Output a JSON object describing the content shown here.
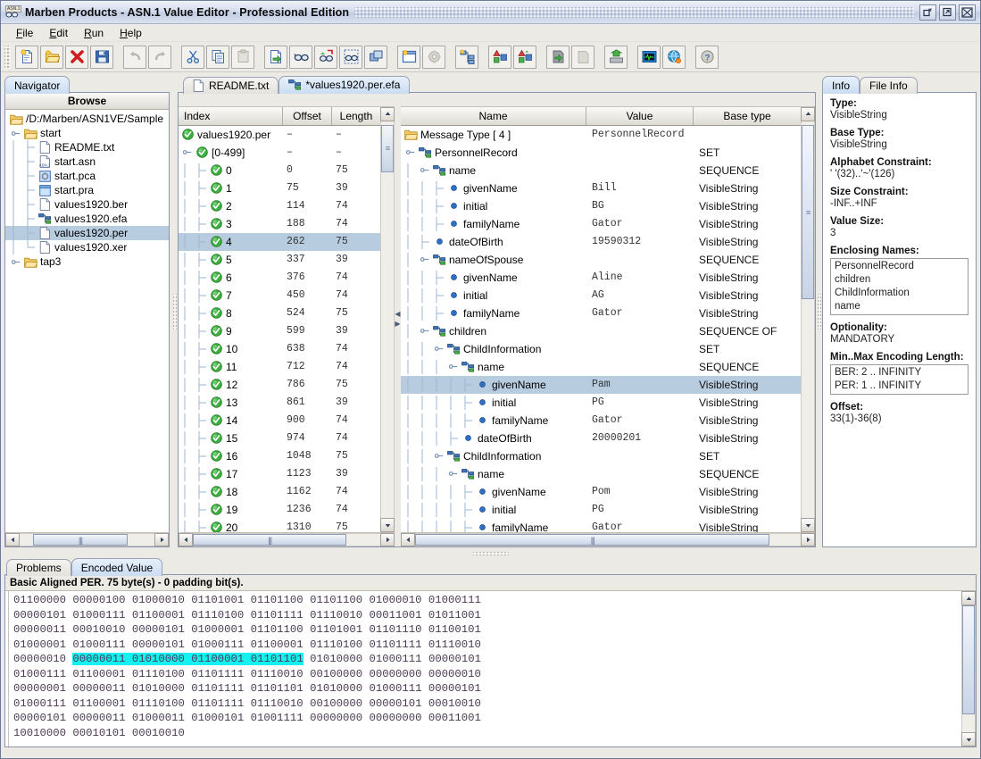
{
  "window": {
    "title": "Marben Products - ASN.1 Value Editor - Professional Edition",
    "icon": "asn1-glasses-icon",
    "buttons": [
      {
        "name": "minimize-button",
        "glyph": "▫"
      },
      {
        "name": "maximize-button",
        "glyph": "▫"
      },
      {
        "name": "close-button",
        "glyph": "✕"
      }
    ]
  },
  "menubar": {
    "items": [
      {
        "label": "File",
        "mnemonic": "F"
      },
      {
        "label": "Edit",
        "mnemonic": "E"
      },
      {
        "label": "Run",
        "mnemonic": "R"
      },
      {
        "label": "Help",
        "mnemonic": "H"
      }
    ]
  },
  "toolbar": {
    "buttons": [
      {
        "name": "new-file-button",
        "icon": "new-document-icon",
        "enabled": true
      },
      {
        "name": "open-file-button",
        "icon": "open-folder-icon",
        "enabled": true
      },
      {
        "name": "delete-button",
        "icon": "red-x-icon",
        "enabled": true
      },
      {
        "name": "save-button",
        "icon": "floppy-disk-icon",
        "enabled": true
      },
      {
        "name": "undo-button",
        "icon": "undo-arrow-icon",
        "enabled": false
      },
      {
        "name": "redo-button",
        "icon": "redo-arrow-icon",
        "enabled": false
      },
      {
        "name": "cut-button",
        "icon": "scissors-icon",
        "enabled": true
      },
      {
        "name": "copy-button",
        "icon": "copy-pages-icon",
        "enabled": true
      },
      {
        "name": "paste-button",
        "icon": "clipboard-icon",
        "enabled": false
      },
      {
        "name": "import-button",
        "icon": "document-green-arrow-icon",
        "enabled": true
      },
      {
        "name": "view-button",
        "icon": "glasses-icon",
        "enabled": true
      },
      {
        "name": "decode-button",
        "icon": "glasses-red-arrow-icon",
        "enabled": true
      },
      {
        "name": "select-view-button",
        "icon": "glasses-dashed-box-icon",
        "enabled": true
      },
      {
        "name": "window-cascade-button",
        "icon": "windows-stack-icon",
        "enabled": true
      },
      {
        "name": "new-window-button",
        "icon": "window-new-icon",
        "enabled": true
      },
      {
        "name": "settings-button",
        "icon": "gear-icon",
        "enabled": false
      },
      {
        "name": "schema-tree-button",
        "icon": "schema-node-icon",
        "enabled": true
      },
      {
        "name": "encode-ber-button",
        "icon": "shapes-blue-icon",
        "enabled": true
      },
      {
        "name": "encode-per-button",
        "icon": "shapes-green-icon",
        "enabled": true
      },
      {
        "name": "save-value-button",
        "icon": "disk-green-arrow-icon",
        "enabled": true
      },
      {
        "name": "load-value-button",
        "icon": "disk-gray-icon",
        "enabled": false
      },
      {
        "name": "export-button",
        "icon": "tray-up-arrow-icon",
        "enabled": true
      },
      {
        "name": "monitor-button",
        "icon": "monitor-icon",
        "enabled": true
      },
      {
        "name": "web-button",
        "icon": "globe-icon",
        "enabled": true
      },
      {
        "name": "help-button",
        "icon": "question-help-icon",
        "enabled": true
      }
    ]
  },
  "navigator": {
    "tab_label": "Navigator",
    "browse_header": "Browse",
    "tree": [
      {
        "label": "/D:/Marben/ASN1VE/Sample",
        "depth": 0,
        "icon": "folder-icon",
        "handle": "none",
        "selected": false
      },
      {
        "label": "start",
        "depth": 1,
        "icon": "folder-icon",
        "handle": "expanded",
        "selected": false
      },
      {
        "label": "README.txt",
        "depth": 2,
        "icon": "text-file-icon",
        "handle": "none",
        "selected": false
      },
      {
        "label": "start.asn",
        "depth": 2,
        "icon": "asn-file-icon",
        "handle": "none",
        "selected": false
      },
      {
        "label": "start.pca",
        "depth": 2,
        "icon": "pca-file-icon",
        "handle": "none",
        "selected": false
      },
      {
        "label": "start.pra",
        "depth": 2,
        "icon": "pra-file-icon",
        "handle": "collapsed",
        "selected": false
      },
      {
        "label": "values1920.ber",
        "depth": 2,
        "icon": "text-file-icon",
        "handle": "none",
        "selected": false
      },
      {
        "label": "values1920.efa",
        "depth": 2,
        "icon": "efa-file-icon",
        "handle": "none",
        "selected": false
      },
      {
        "label": "values1920.per",
        "depth": 2,
        "icon": "text-file-icon",
        "handle": "none",
        "selected": true
      },
      {
        "label": "values1920.xer",
        "depth": 2,
        "icon": "text-file-icon",
        "handle": "none",
        "selected": false
      },
      {
        "label": "tap3",
        "depth": 1,
        "icon": "folder-icon",
        "handle": "collapsed",
        "selected": false
      }
    ]
  },
  "editor": {
    "tabs": [
      {
        "label": "README.txt",
        "icon": "text-file-icon",
        "active": false
      },
      {
        "label": "*values1920.per.efa",
        "icon": "efa-file-icon",
        "active": true
      }
    ]
  },
  "index_grid": {
    "columns": [
      "Index",
      "Offset",
      "Length"
    ],
    "rows": [
      {
        "index": "values1920.per",
        "offset": "–",
        "length": "–",
        "depth": 0,
        "icon": "green-check-icon",
        "handle": "none",
        "selected": false
      },
      {
        "index": "[0-499]",
        "offset": "–",
        "length": "–",
        "depth": 1,
        "icon": "green-check-icon",
        "handle": "expanded",
        "selected": false
      },
      {
        "index": "0",
        "offset": "0",
        "length": "75",
        "depth": 2,
        "icon": "green-check-icon",
        "handle": "none",
        "selected": false
      },
      {
        "index": "1",
        "offset": "75",
        "length": "39",
        "depth": 2,
        "icon": "green-check-icon",
        "handle": "none",
        "selected": false
      },
      {
        "index": "2",
        "offset": "114",
        "length": "74",
        "depth": 2,
        "icon": "green-check-icon",
        "handle": "none",
        "selected": false
      },
      {
        "index": "3",
        "offset": "188",
        "length": "74",
        "depth": 2,
        "icon": "green-check-icon",
        "handle": "none",
        "selected": false
      },
      {
        "index": "4",
        "offset": "262",
        "length": "75",
        "depth": 2,
        "icon": "green-check-icon",
        "handle": "none",
        "selected": true
      },
      {
        "index": "5",
        "offset": "337",
        "length": "39",
        "depth": 2,
        "icon": "green-check-icon",
        "handle": "none",
        "selected": false
      },
      {
        "index": "6",
        "offset": "376",
        "length": "74",
        "depth": 2,
        "icon": "green-check-icon",
        "handle": "none",
        "selected": false
      },
      {
        "index": "7",
        "offset": "450",
        "length": "74",
        "depth": 2,
        "icon": "green-check-icon",
        "handle": "none",
        "selected": false
      },
      {
        "index": "8",
        "offset": "524",
        "length": "75",
        "depth": 2,
        "icon": "green-check-icon",
        "handle": "none",
        "selected": false
      },
      {
        "index": "9",
        "offset": "599",
        "length": "39",
        "depth": 2,
        "icon": "green-check-icon",
        "handle": "none",
        "selected": false
      },
      {
        "index": "10",
        "offset": "638",
        "length": "74",
        "depth": 2,
        "icon": "green-check-icon",
        "handle": "none",
        "selected": false
      },
      {
        "index": "11",
        "offset": "712",
        "length": "74",
        "depth": 2,
        "icon": "green-check-icon",
        "handle": "none",
        "selected": false
      },
      {
        "index": "12",
        "offset": "786",
        "length": "75",
        "depth": 2,
        "icon": "green-check-icon",
        "handle": "none",
        "selected": false
      },
      {
        "index": "13",
        "offset": "861",
        "length": "39",
        "depth": 2,
        "icon": "green-check-icon",
        "handle": "none",
        "selected": false
      },
      {
        "index": "14",
        "offset": "900",
        "length": "74",
        "depth": 2,
        "icon": "green-check-icon",
        "handle": "none",
        "selected": false
      },
      {
        "index": "15",
        "offset": "974",
        "length": "74",
        "depth": 2,
        "icon": "green-check-icon",
        "handle": "none",
        "selected": false
      },
      {
        "index": "16",
        "offset": "1048",
        "length": "75",
        "depth": 2,
        "icon": "green-check-icon",
        "handle": "none",
        "selected": false
      },
      {
        "index": "17",
        "offset": "1123",
        "length": "39",
        "depth": 2,
        "icon": "green-check-icon",
        "handle": "none",
        "selected": false
      },
      {
        "index": "18",
        "offset": "1162",
        "length": "74",
        "depth": 2,
        "icon": "green-check-icon",
        "handle": "none",
        "selected": false
      },
      {
        "index": "19",
        "offset": "1236",
        "length": "74",
        "depth": 2,
        "icon": "green-check-icon",
        "handle": "none",
        "selected": false
      },
      {
        "index": "20",
        "offset": "1310",
        "length": "75",
        "depth": 2,
        "icon": "green-check-icon",
        "handle": "none",
        "selected": false
      }
    ]
  },
  "value_grid": {
    "columns": [
      "Name",
      "Value",
      "Base type"
    ],
    "rows": [
      {
        "name": "Message Type [ 4 ]",
        "value": "PersonnelRecord",
        "base_type": "",
        "depth": 0,
        "icon": "folder-icon",
        "handle": "none",
        "selected": false
      },
      {
        "name": "PersonnelRecord",
        "value": "",
        "base_type": "SET",
        "depth": 1,
        "icon": "node-icon",
        "handle": "expanded",
        "selected": false
      },
      {
        "name": "name",
        "value": "",
        "base_type": "SEQUENCE",
        "depth": 2,
        "icon": "node-icon",
        "handle": "expanded",
        "selected": false
      },
      {
        "name": "givenName",
        "value": "Bill",
        "base_type": "VisibleString",
        "depth": 3,
        "icon": "leaf-dot-icon",
        "handle": "none",
        "selected": false
      },
      {
        "name": "initial",
        "value": "BG",
        "base_type": "VisibleString",
        "depth": 3,
        "icon": "leaf-dot-icon",
        "handle": "none",
        "selected": false
      },
      {
        "name": "familyName",
        "value": "Gator",
        "base_type": "VisibleString",
        "depth": 3,
        "icon": "leaf-dot-icon",
        "handle": "none",
        "selected": false
      },
      {
        "name": "dateOfBirth",
        "value": "19590312",
        "base_type": "VisibleString",
        "depth": 2,
        "icon": "leaf-dot-icon",
        "handle": "none",
        "selected": false
      },
      {
        "name": "nameOfSpouse",
        "value": "",
        "base_type": "SEQUENCE",
        "depth": 2,
        "icon": "node-icon",
        "handle": "expanded",
        "selected": false
      },
      {
        "name": "givenName",
        "value": "Aline",
        "base_type": "VisibleString",
        "depth": 3,
        "icon": "leaf-dot-icon",
        "handle": "none",
        "selected": false
      },
      {
        "name": "initial",
        "value": "AG",
        "base_type": "VisibleString",
        "depth": 3,
        "icon": "leaf-dot-icon",
        "handle": "none",
        "selected": false
      },
      {
        "name": "familyName",
        "value": "Gator",
        "base_type": "VisibleString",
        "depth": 3,
        "icon": "leaf-dot-icon",
        "handle": "none",
        "selected": false
      },
      {
        "name": "children",
        "value": "",
        "base_type": "SEQUENCE OF",
        "depth": 2,
        "icon": "node-icon",
        "handle": "expanded",
        "selected": false
      },
      {
        "name": "ChildInformation",
        "value": "",
        "base_type": "SET",
        "depth": 3,
        "icon": "node-icon",
        "handle": "expanded",
        "selected": false
      },
      {
        "name": "name",
        "value": "",
        "base_type": "SEQUENCE",
        "depth": 4,
        "icon": "node-icon",
        "handle": "expanded",
        "selected": false
      },
      {
        "name": "givenName",
        "value": "Pam",
        "base_type": "VisibleString",
        "depth": 5,
        "icon": "leaf-dot-icon",
        "handle": "none",
        "selected": true
      },
      {
        "name": "initial",
        "value": "PG",
        "base_type": "VisibleString",
        "depth": 5,
        "icon": "leaf-dot-icon",
        "handle": "none",
        "selected": false
      },
      {
        "name": "familyName",
        "value": "Gator",
        "base_type": "VisibleString",
        "depth": 5,
        "icon": "leaf-dot-icon",
        "handle": "none",
        "selected": false
      },
      {
        "name": "dateOfBirth",
        "value": "20000201",
        "base_type": "VisibleString",
        "depth": 4,
        "icon": "leaf-dot-icon",
        "handle": "none",
        "selected": false
      },
      {
        "name": "ChildInformation",
        "value": "",
        "base_type": "SET",
        "depth": 3,
        "icon": "node-icon",
        "handle": "expanded",
        "selected": false
      },
      {
        "name": "name",
        "value": "",
        "base_type": "SEQUENCE",
        "depth": 4,
        "icon": "node-icon",
        "handle": "expanded",
        "selected": false
      },
      {
        "name": "givenName",
        "value": "Pom",
        "base_type": "VisibleString",
        "depth": 5,
        "icon": "leaf-dot-icon",
        "handle": "none",
        "selected": false
      },
      {
        "name": "initial",
        "value": "PG",
        "base_type": "VisibleString",
        "depth": 5,
        "icon": "leaf-dot-icon",
        "handle": "none",
        "selected": false
      },
      {
        "name": "familyName",
        "value": "Gator",
        "base_type": "VisibleString",
        "depth": 5,
        "icon": "leaf-dot-icon",
        "handle": "none",
        "selected": false
      }
    ]
  },
  "info": {
    "tabs": [
      {
        "label": "Info",
        "active": true
      },
      {
        "label": "File Info",
        "active": false
      }
    ],
    "fields": [
      {
        "label": "Type:",
        "value": "VisibleString",
        "kind": "text"
      },
      {
        "label": "Base Type:",
        "value": "VisibleString",
        "kind": "text"
      },
      {
        "label": "Alphabet Constraint:",
        "value": "' '(32)..'~'(126)",
        "kind": "text"
      },
      {
        "label": "Size Constraint:",
        "value": "-INF..+INF",
        "kind": "text"
      },
      {
        "label": "Value Size:",
        "value": "3",
        "kind": "text"
      },
      {
        "label": "Enclosing Names:",
        "kind": "list",
        "items": [
          "PersonnelRecord",
          "children",
          "ChildInformation",
          "name"
        ]
      },
      {
        "label": "Optionality:",
        "value": "MANDATORY",
        "kind": "text"
      },
      {
        "label": "Min..Max Encoding Length:",
        "kind": "list",
        "items": [
          "BER: 2 .. INFINITY",
          "PER: 1 .. INFINITY"
        ]
      },
      {
        "label": "Offset:",
        "value": "33(1)-36(8)",
        "kind": "text"
      }
    ]
  },
  "bottom": {
    "tabs": [
      {
        "label": "Problems",
        "active": false
      },
      {
        "label": "Encoded Value",
        "active": true
      }
    ],
    "status": "Basic Aligned PER. 75 byte(s) - 0 padding bit(s).",
    "hex_lines": [
      {
        "bytes": "01100000 00000100 01000010 01101001 01101100 01101100 01000010 01000111",
        "comment": "<!--`.BillBG-->",
        "hl_start": -1,
        "hl_end": -1
      },
      {
        "bytes": "00000101 01000111 01100001 01110100 01101111 01110010 00011001 01011001",
        "comment": "<!--.Gator.Y-->",
        "hl_start": -1,
        "hl_end": -1
      },
      {
        "bytes": "00000011 00010010 00000101 01000001 01101100 01101001 01101110 01100101",
        "comment": "<!--...Aline-->",
        "hl_start": -1,
        "hl_end": -1
      },
      {
        "bytes": "01000001 01000111 00000101 01000111 01100001 01110100 01101111 01110010",
        "comment": "<!--AG.Gator-->",
        "hl_start": -1,
        "hl_end": -1
      },
      {
        "bytes": "00000010 00000011 01010000 01100001 01101101 01010000 01000111 00000101",
        "comment": "<!--..PamPG.-->",
        "hl_start": 1,
        "hl_end": 4,
        "cmt_hl": "Pam"
      },
      {
        "bytes": "01000111 01100001 01110100 01101111 01110010 00100000 00000000 00000010",
        "comment": "<!--Gator ..-->",
        "hl_start": -1,
        "hl_end": -1
      },
      {
        "bytes": "00000001 00000011 01010000 01101111 01101101 01010000 01000111 00000101",
        "comment": "<!--..PomPG.-->",
        "hl_start": -1,
        "hl_end": -1
      },
      {
        "bytes": "01000111 01100001 01110100 01101111 01110010 00100000 00000101 00010010",
        "comment": "<!--Gator ..-->",
        "hl_start": -1,
        "hl_end": -1
      },
      {
        "bytes": "00000101 00000011 01000011 01000101 01001111 00000000 00000000 00011001",
        "comment": "<!--..CEO...-->",
        "hl_start": -1,
        "hl_end": -1
      },
      {
        "bytes": "10010000 00010101 00010010",
        "comment": "<!--...-->",
        "hl_start": -1,
        "hl_end": -1
      }
    ]
  },
  "colors": {
    "selection": "#b8cce0",
    "highlight": "#14f1f1",
    "accent": "#3b6ea5",
    "hex_text": "#4a3a52"
  }
}
